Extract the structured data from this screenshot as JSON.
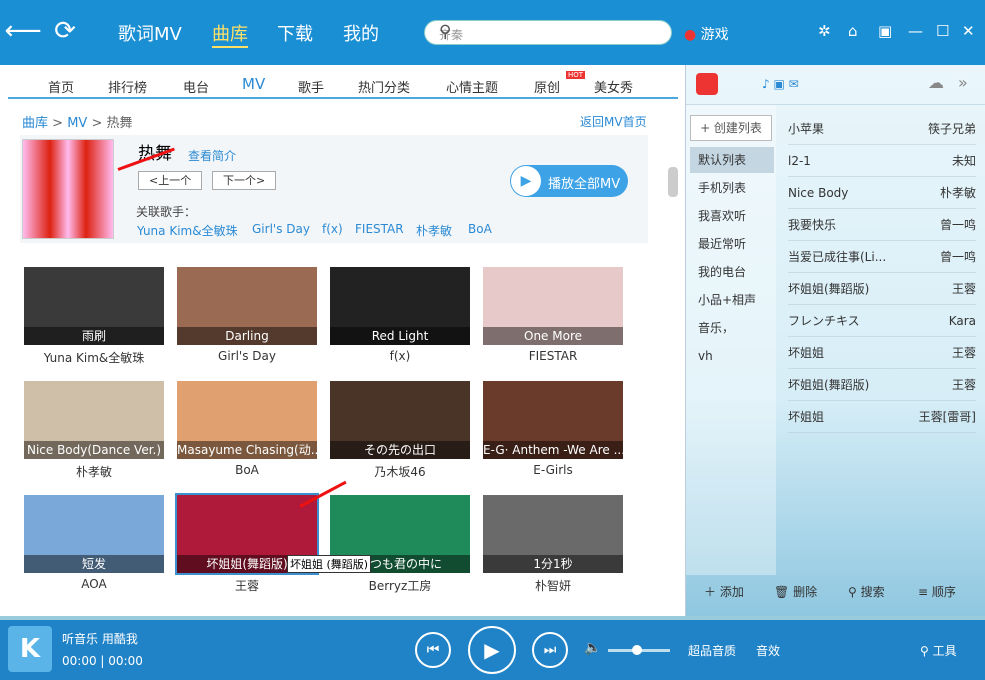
{
  "top": {
    "tabs": [
      "歌词MV",
      "曲库",
      "下载",
      "我的"
    ],
    "search_placeholder": "齐秦",
    "game": "游戏"
  },
  "subnav": [
    "首页",
    "排行榜",
    "电台",
    "MV",
    "歌手",
    "热门分类",
    "心情主题",
    "原创",
    "美女秀"
  ],
  "hot_badge": "HOT",
  "crumb": {
    "a": "曲库",
    "b": "MV",
    "c": "热舞",
    "sep": ">"
  },
  "back": "返回MV首页",
  "info": {
    "title": "热舞",
    "intro": "查看简介",
    "prev": "<上一个",
    "next": "下一个>",
    "rel_label": "关联歌手：",
    "artists": [
      "Yuna Kim&全敏珠",
      "Girl's Day",
      "f(x)",
      "FIESTAR",
      "朴孝敏",
      "BoA"
    ],
    "play_all": "播放全部MV"
  },
  "cards": [
    {
      "cap": "雨刷",
      "artist": "Yuna Kim&全敏珠",
      "bg": "#3a3a3a"
    },
    {
      "cap": "Darling",
      "artist": "Girl's Day",
      "bg": "#9a6a52"
    },
    {
      "cap": "Red Light",
      "artist": "f(x)",
      "bg": "#222"
    },
    {
      "cap": "One More",
      "artist": "FIESTAR",
      "bg": "#e8c9c9"
    },
    {
      "cap": "Nice Body(Dance Ver.)",
      "artist": "朴孝敏",
      "bg": "#cfbfa8"
    },
    {
      "cap": "Masayume Chasing(动...",
      "artist": "BoA",
      "bg": "#e0a070"
    },
    {
      "cap": "その先の出口",
      "artist": "乃木坂46",
      "bg": "#4a3428"
    },
    {
      "cap": "E-G· Anthem -We Are ...",
      "artist": "E-Girls",
      "bg": "#6a3a2a"
    },
    {
      "cap": "短发",
      "artist": "AOA",
      "bg": "#7aa8d8"
    },
    {
      "cap": "坏姐姐(舞蹈版)",
      "artist": "王蓉",
      "bg": "#b01a3a"
    },
    {
      "cap": "いつも君の中に",
      "artist": "Berryz工房",
      "bg": "#1f8a5a"
    },
    {
      "cap": "1分1秒",
      "artist": "朴智妍",
      "bg": "#6a6a6a"
    }
  ],
  "tooltip": "坏姐姐 (舞蹈版)",
  "playlists": {
    "create": "+ 创建列表",
    "items": [
      "默认列表",
      "手机列表",
      "我喜欢听",
      "最近常听",
      "我的电台",
      "小品+相声",
      "音乐，",
      "vh"
    ]
  },
  "songs": [
    {
      "n": "小苹果",
      "a": "筷子兄弟"
    },
    {
      "n": "l2-1",
      "a": "未知"
    },
    {
      "n": "Nice Body",
      "a": "朴孝敏"
    },
    {
      "n": "我要快乐",
      "a": "曾一鸣"
    },
    {
      "n": "当爱已成往事(Li...",
      "a": "曾一鸣"
    },
    {
      "n": "坏姐姐(舞蹈版)",
      "a": "王蓉"
    },
    {
      "n": "フレンチキス",
      "a": "Kara"
    },
    {
      "n": "坏姐姐",
      "a": "王蓉"
    },
    {
      "n": "坏姐姐(舞蹈版)",
      "a": "王蓉"
    },
    {
      "n": "坏姐姐",
      "a": "王蓉[雷哥]"
    }
  ],
  "rbot": [
    "添加",
    "删除",
    "搜索",
    "顺序"
  ],
  "player": {
    "title": "听音乐 用酷我",
    "time": "00:00 | 00:00",
    "quality": "超品音质",
    "tools": "工具",
    "effects": "音效"
  }
}
